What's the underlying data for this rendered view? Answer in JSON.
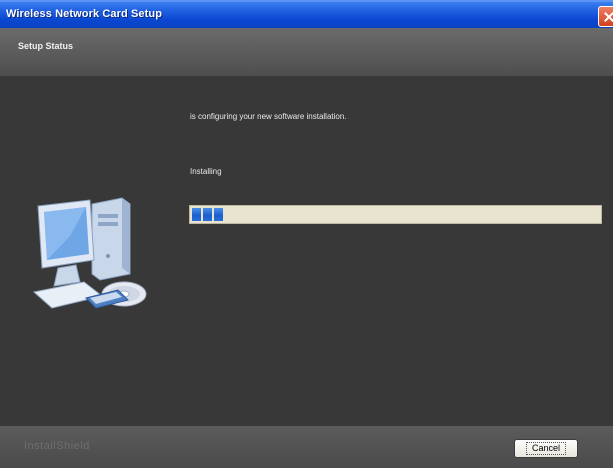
{
  "window": {
    "title": "Wireless Network Card Setup"
  },
  "header": {
    "title": "Setup Status"
  },
  "content": {
    "status_message": "is configuring your new software installation.",
    "progress_label": "Installing",
    "progress_segments": 3
  },
  "footer": {
    "brand": "InstallShield",
    "cancel_label": "Cancel"
  },
  "icons": {
    "close": "close-icon",
    "illustration": "computer-icon"
  }
}
